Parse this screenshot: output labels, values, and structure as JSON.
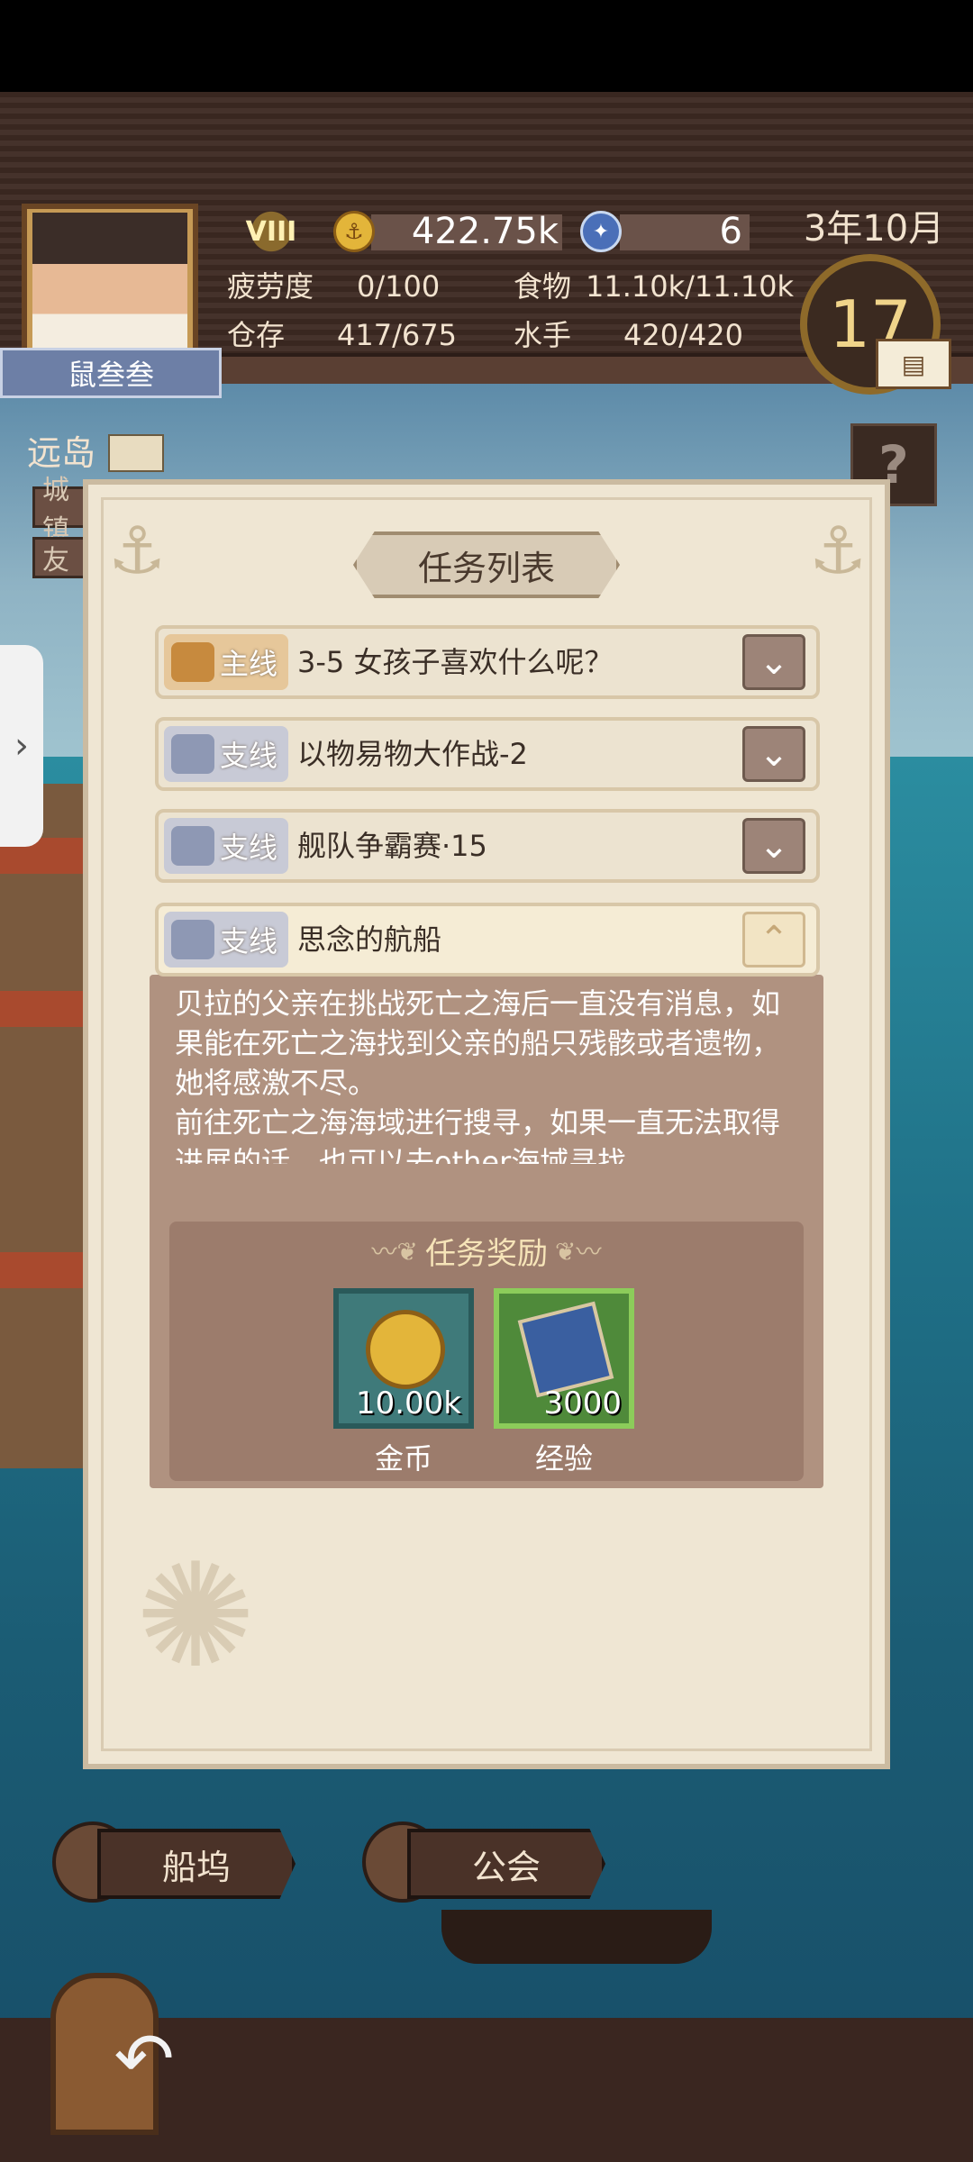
{
  "hud": {
    "player_name": "鼠叁叁",
    "rank": "VIII",
    "gold": "422.75k",
    "gems": "6",
    "date": "3年10月",
    "day": "17",
    "fatigue_label": "疲劳度",
    "fatigue_value": "0/100",
    "food_label": "食物",
    "food_value": "11.10k/11.10k",
    "storage_label": "仓存",
    "storage_value": "417/675",
    "sailors_label": "水手",
    "sailors_value": "420/420"
  },
  "location": {
    "name": "远岛",
    "btn1": "城镇",
    "btn2": "友",
    "help": "?"
  },
  "bottom_nav": {
    "dock": "船坞",
    "guild": "公会"
  },
  "dialog": {
    "title": "任务列表",
    "quests": [
      {
        "tag": "主线",
        "title": "3-5 女孩子喜欢什么呢？",
        "type": "main",
        "expanded": false
      },
      {
        "tag": "支线",
        "title": "以物易物大作战-2",
        "type": "side",
        "expanded": false
      },
      {
        "tag": "支线",
        "title": "舰队争霸赛·15",
        "type": "side",
        "expanded": false
      },
      {
        "tag": "支线",
        "title": "思念的航船",
        "type": "side",
        "expanded": true
      }
    ],
    "description": "贝拉的父亲在挑战死亡之海后一直没有消息，如果能在死亡之海找到父亲的船只残骸或者遗物，她将感激不尽。\n前往死亡之海海域进行搜寻，如果一直无法取得进展的话，也可以去other海域寻找",
    "reward_title": "任务奖励",
    "rewards": [
      {
        "name": "金币",
        "amount": "10.00k",
        "color": "#3f7a7a",
        "border": "#2a5a5a"
      },
      {
        "name": "经验",
        "amount": "3000",
        "color": "#4f8a3a",
        "border": "#8ccc5a"
      }
    ]
  },
  "icons": {
    "toggle_down": "chevron-down-icon",
    "toggle_up": "chevron-up-icon",
    "side_tab": "chevron-right-icon"
  }
}
